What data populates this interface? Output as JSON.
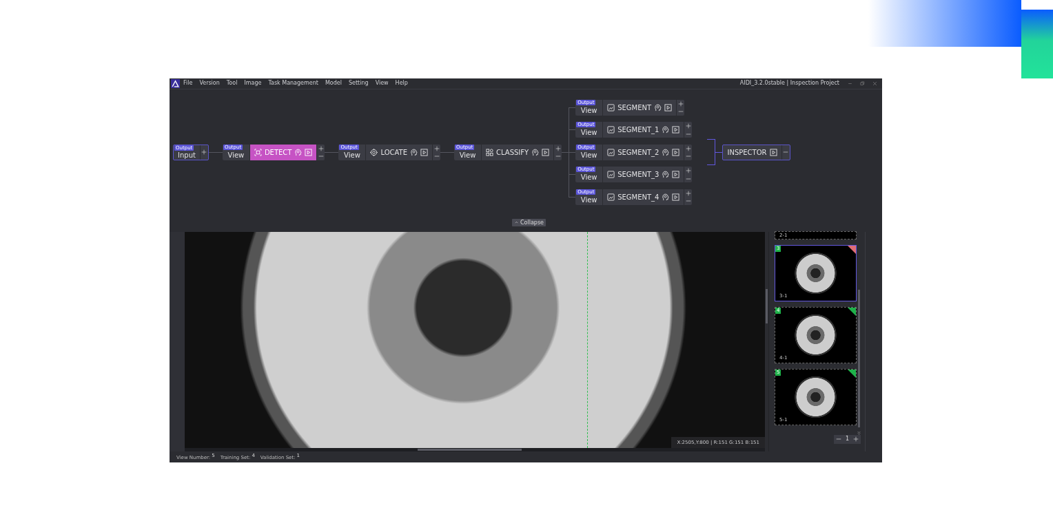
{
  "window": {
    "title": "AIDI_3.2.0stable | Inspection Project"
  },
  "menu": [
    "File",
    "Version",
    "Tool",
    "Image",
    "Task Management",
    "Model",
    "Setting",
    "View",
    "Help"
  ],
  "pipeline": {
    "input": {
      "badge": "Output",
      "label": "Input"
    },
    "chain": [
      {
        "kind": "detect",
        "badge": "Output",
        "view": "View",
        "task": "DETECT",
        "selected": true
      },
      {
        "kind": "locate",
        "badge": "Output",
        "view": "View",
        "task": "LOCATE",
        "selected": false
      },
      {
        "kind": "classify",
        "badge": "Output",
        "view": "View",
        "task": "CLASSIFY",
        "selected": false
      }
    ],
    "branches": [
      {
        "kind": "segment",
        "badge": "Output",
        "view": "View",
        "task": "SEGMENT",
        "selected": false
      },
      {
        "kind": "segment",
        "badge": "Output",
        "view": "View",
        "task": "SEGMENT_1",
        "selected": false
      },
      {
        "kind": "segment",
        "badge": "Output",
        "view": "View",
        "task": "SEGMENT_2",
        "selected": false
      },
      {
        "kind": "segment",
        "badge": "Output",
        "view": "View",
        "task": "SEGMENT_3",
        "selected": false
      },
      {
        "kind": "segment",
        "badge": "Output",
        "view": "View",
        "task": "SEGMENT_4",
        "selected": false
      }
    ],
    "output": {
      "label": "INSPECTOR"
    }
  },
  "collapse": "Collapse",
  "viewer": {
    "readout": "X:2505,Y:800 | R:151 G:151 B:151"
  },
  "thumbnails": [
    {
      "kind": "cut",
      "label": "2-1"
    },
    {
      "kind": "full",
      "badge": "3",
      "label": "3-1",
      "color": "#e06c75",
      "selected": true
    },
    {
      "kind": "full",
      "badge": "4",
      "label": "4-1",
      "color": "#1fb24a",
      "selected": false
    },
    {
      "kind": "full",
      "badge": "5",
      "label": "5-1",
      "color": "#1fb24a",
      "selected": false
    }
  ],
  "pager": {
    "page": "1"
  },
  "status_bar": [
    {
      "label": "View Number:",
      "value": "5"
    },
    {
      "label": "Training Set:",
      "value": "4"
    },
    {
      "label": "Validation Set:",
      "value": "1"
    }
  ]
}
